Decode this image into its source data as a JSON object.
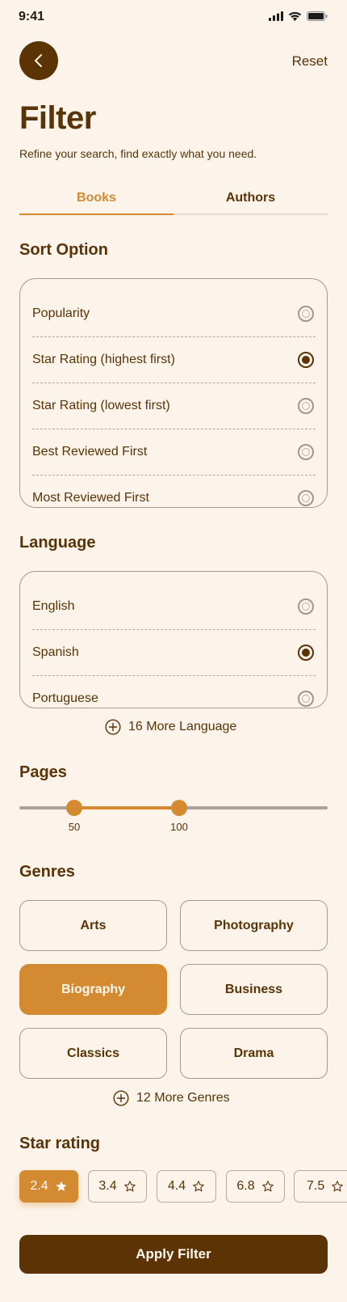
{
  "status_bar": {
    "time": "9:41"
  },
  "header": {
    "reset_label": "Reset",
    "title": "Filter",
    "subtitle": "Refine your search, find exactly what you need."
  },
  "tabs": [
    {
      "label": "Books",
      "active": true
    },
    {
      "label": "Authors",
      "active": false
    }
  ],
  "sort": {
    "title": "Sort Option",
    "options": [
      {
        "label": "Popularity",
        "selected": false
      },
      {
        "label": "Star Rating (highest first)",
        "selected": true
      },
      {
        "label": "Star Rating (lowest first)",
        "selected": false
      },
      {
        "label": "Best Reviewed First",
        "selected": false
      },
      {
        "label": "Most Reviewed First",
        "selected": false
      }
    ]
  },
  "language": {
    "title": "Language",
    "options": [
      {
        "label": "English",
        "selected": false
      },
      {
        "label": "Spanish",
        "selected": true
      },
      {
        "label": "Portuguese",
        "selected": false
      }
    ],
    "more_label": "16 More Language"
  },
  "pages": {
    "title": "Pages",
    "min_label": "50",
    "max_label": "100"
  },
  "genres": {
    "title": "Genres",
    "items": [
      {
        "label": "Arts",
        "active": false
      },
      {
        "label": "Photography",
        "active": false
      },
      {
        "label": "Biography",
        "active": true
      },
      {
        "label": "Business",
        "active": false
      },
      {
        "label": "Classics",
        "active": false
      },
      {
        "label": "Drama",
        "active": false
      }
    ],
    "more_label": "12 More Genres"
  },
  "star_rating": {
    "title": "Star rating",
    "items": [
      {
        "value": "2.4",
        "active": true
      },
      {
        "value": "3.4",
        "active": false
      },
      {
        "value": "4.4",
        "active": false
      },
      {
        "value": "6.8",
        "active": false
      },
      {
        "value": "7.5",
        "active": false
      }
    ]
  },
  "apply_label": "Apply Filter",
  "colors": {
    "background": "#FCF4EA",
    "primary_dark": "#5C3304",
    "accent": "#D48A30"
  }
}
